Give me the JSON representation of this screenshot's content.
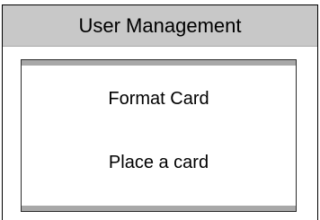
{
  "window": {
    "title": "User Management"
  },
  "dialog": {
    "items": [
      {
        "label": "Format Card"
      },
      {
        "label": "Place a card"
      }
    ]
  },
  "colors": {
    "titlebar_bg": "#c8c8c8",
    "dialog_bars": "#a8a8a8",
    "border": "#000000"
  }
}
